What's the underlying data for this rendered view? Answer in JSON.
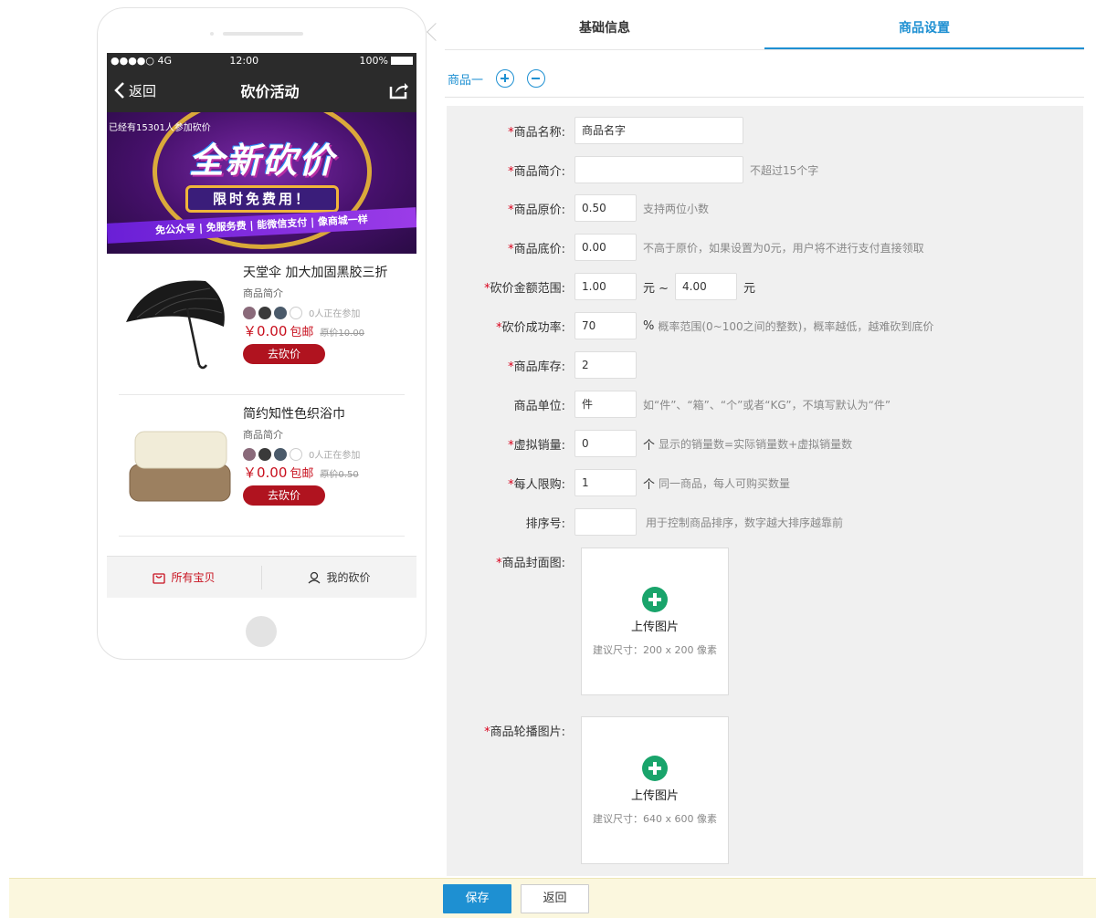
{
  "phone": {
    "status": {
      "signal": "●●●●○ 4G",
      "time": "12:00",
      "battery": "100%"
    },
    "nav": {
      "back_label": "返回",
      "title": "砍价活动"
    },
    "banner": {
      "joined_text": "已经有15301人参加砍价",
      "headline": "全新砍价",
      "badge": "限时免费用！",
      "tagline": "免公众号 | 免服务费 | 能微信支付 | 像商城一样"
    },
    "products": [
      {
        "name": "天堂伞 加大加固黑胶三折",
        "desc": "商品简介",
        "join_count": "0人正在参加",
        "price": "￥0.00",
        "free_ship": "包邮",
        "orig_price": "原价10.00",
        "button": "去砍价"
      },
      {
        "name": "简约知性色织浴巾",
        "desc": "商品简介",
        "join_count": "0人正在参加",
        "price": "￥0.00",
        "free_ship": "包邮",
        "orig_price": "原价0.50",
        "button": "去砍价"
      }
    ],
    "tabbar": {
      "all_items": "所有宝贝",
      "my_bargain": "我的砍价"
    }
  },
  "tabs": {
    "basic": "基础信息",
    "product_settings": "商品设置"
  },
  "product_bar": {
    "label": "商品一"
  },
  "form": {
    "name": {
      "label": "商品名称:",
      "value": "商品名字"
    },
    "intro": {
      "label": "商品简介:",
      "value": "",
      "hint": "不超过15个字"
    },
    "orig_price": {
      "label": "商品原价:",
      "value": "0.50",
      "hint": "支持两位小数"
    },
    "floor_price": {
      "label": "商品底价:",
      "value": "0.00",
      "hint": "不高于原价，如果设置为0元，用户将不进行支付直接领取"
    },
    "cut_range": {
      "label": "砍价金额范围:",
      "min": "1.00",
      "unit1": "元 ~",
      "max": "4.00",
      "unit2": "元"
    },
    "success_rate": {
      "label": "砍价成功率:",
      "value": "70",
      "unit": "%",
      "hint": "概率范围(0~100之间的整数)，概率越低，越难砍到底价"
    },
    "stock": {
      "label": "商品库存:",
      "value": "2"
    },
    "unit": {
      "label": "商品单位:",
      "value": "件",
      "hint": "如“件”、“箱”、“个”或者“KG”，不填写默认为“件”"
    },
    "virtual_sales": {
      "label": "虚拟销量:",
      "value": "0",
      "unit": "个",
      "hint": "显示的销量数=实际销量数+虚拟销量数"
    },
    "limit": {
      "label": "每人限购:",
      "value": "1",
      "unit": "个",
      "hint": "同一商品，每人可购买数量"
    },
    "sort": {
      "label": "排序号:",
      "value": "",
      "hint": "用于控制商品排序，数字越大排序越靠前"
    },
    "cover": {
      "label": "商品封面图:",
      "upload_text": "上传图片",
      "size_hint": "建议尺寸：200 x 200 像素"
    },
    "carousel": {
      "label": "商品轮播图片:",
      "upload_text": "上传图片",
      "size_hint": "建议尺寸：640 x 600 像素"
    },
    "required_mark": "*"
  },
  "footer": {
    "save": "保存",
    "back": "返回"
  },
  "colors": {
    "accent": "#1e90d2",
    "price_red": "#c8101e",
    "upload_green": "#19a46b"
  }
}
